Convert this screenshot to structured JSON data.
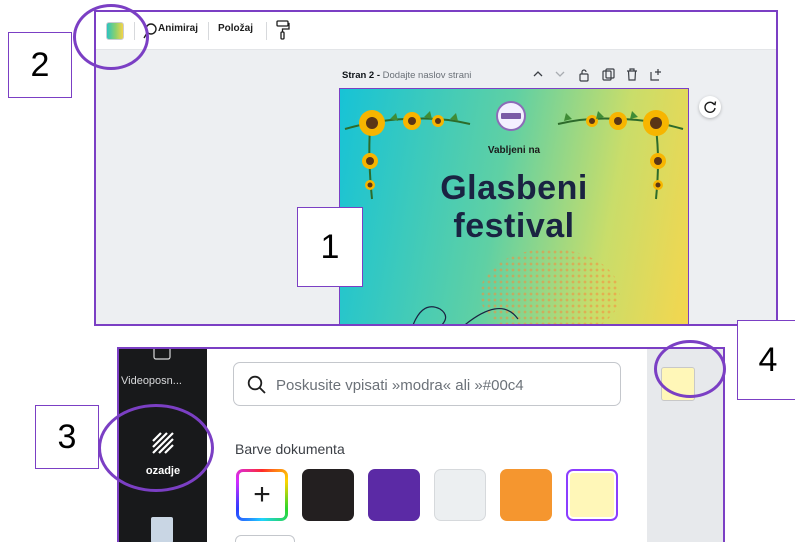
{
  "toolbar": {
    "color_swatch_icon": "gradient-swatch-icon",
    "animate_label": "Animiraj",
    "position_label": "Položaj",
    "paint_format_icon": "paint-roller-icon"
  },
  "page_header": {
    "page_label": "Stran 2 -",
    "page_title_placeholder": "Dodajte naslov strani",
    "action_icons": [
      "chevron-up-icon",
      "chevron-down-icon",
      "lock-icon",
      "duplicate-icon",
      "trash-icon",
      "add-page-icon"
    ]
  },
  "design": {
    "welcome": "Vabljeni na",
    "title_line1": "Glasbeni",
    "title_line2": "festival"
  },
  "callouts": {
    "one": "1",
    "two": "2",
    "three": "3",
    "four": "4"
  },
  "sidebar": {
    "video_label": "Videoposn...",
    "background_label": "ozadje"
  },
  "color_panel": {
    "search_placeholder": "Poskusite vpisati »modra« ali »#00c4",
    "section_title": "Barve dokumenta",
    "add_label": "+",
    "swatches": [
      "#231f20",
      "#5b2aa5",
      "#eceff1",
      "#f5962f",
      "#fff7b8"
    ],
    "selected_swatch": "#fff7b8"
  },
  "colors": {
    "accent_outline": "#7b3fc4"
  }
}
